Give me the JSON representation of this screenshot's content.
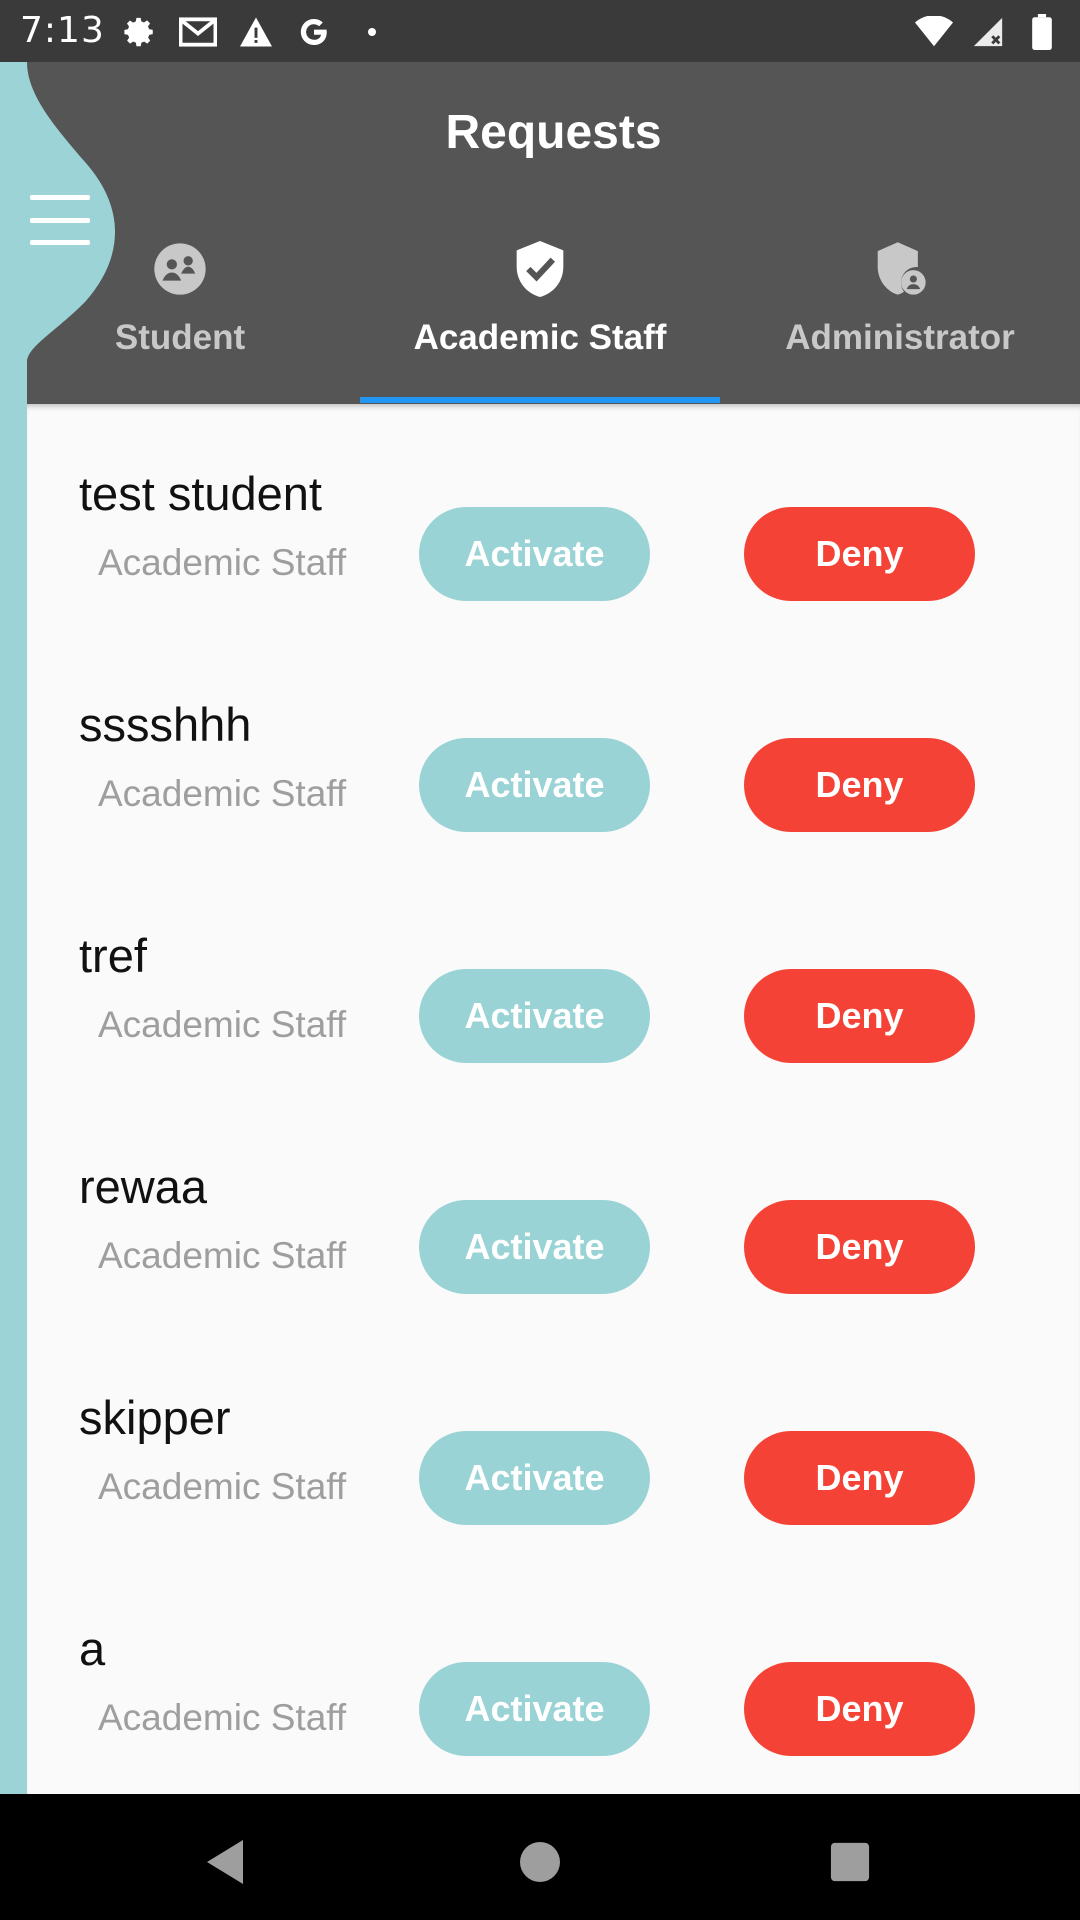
{
  "status_bar": {
    "time": "7:13",
    "left_icons": [
      "settings-icon",
      "gmail-icon",
      "warning-icon",
      "google-icon",
      "dot-icon"
    ],
    "right_icons": [
      "wifi-icon",
      "signal-icon",
      "battery-icon"
    ]
  },
  "header": {
    "title": "Requests",
    "menu_icon": "hamburger-menu-icon"
  },
  "tabs": [
    {
      "label": "Student",
      "icon": "student-group-icon",
      "selected": false
    },
    {
      "label": "Academic Staff",
      "icon": "shield-check-icon",
      "selected": true
    },
    {
      "label": "Administrator",
      "icon": "shield-person-icon",
      "selected": false
    }
  ],
  "colors": {
    "header_bg": "#555555",
    "accent_teal": "#99d3d6",
    "deny_red": "#f44336",
    "tab_indicator": "#2196f3"
  },
  "requests": [
    {
      "name": "test student",
      "role": "Academic Staff",
      "activate_label": "Activate",
      "deny_label": "Deny"
    },
    {
      "name": "sssshhh",
      "role": "Academic Staff",
      "activate_label": "Activate",
      "deny_label": "Deny"
    },
    {
      "name": "tref",
      "role": "Academic Staff",
      "activate_label": "Activate",
      "deny_label": "Deny"
    },
    {
      "name": "rewaa",
      "role": "Academic Staff",
      "activate_label": "Activate",
      "deny_label": "Deny"
    },
    {
      "name": "skipper",
      "role": "Academic Staff",
      "activate_label": "Activate",
      "deny_label": "Deny"
    },
    {
      "name": "a",
      "role": "Academic Staff",
      "activate_label": "Activate",
      "deny_label": "Deny"
    }
  ],
  "nav_bar": {
    "icons": [
      "back-icon",
      "home-icon",
      "recents-icon"
    ]
  }
}
